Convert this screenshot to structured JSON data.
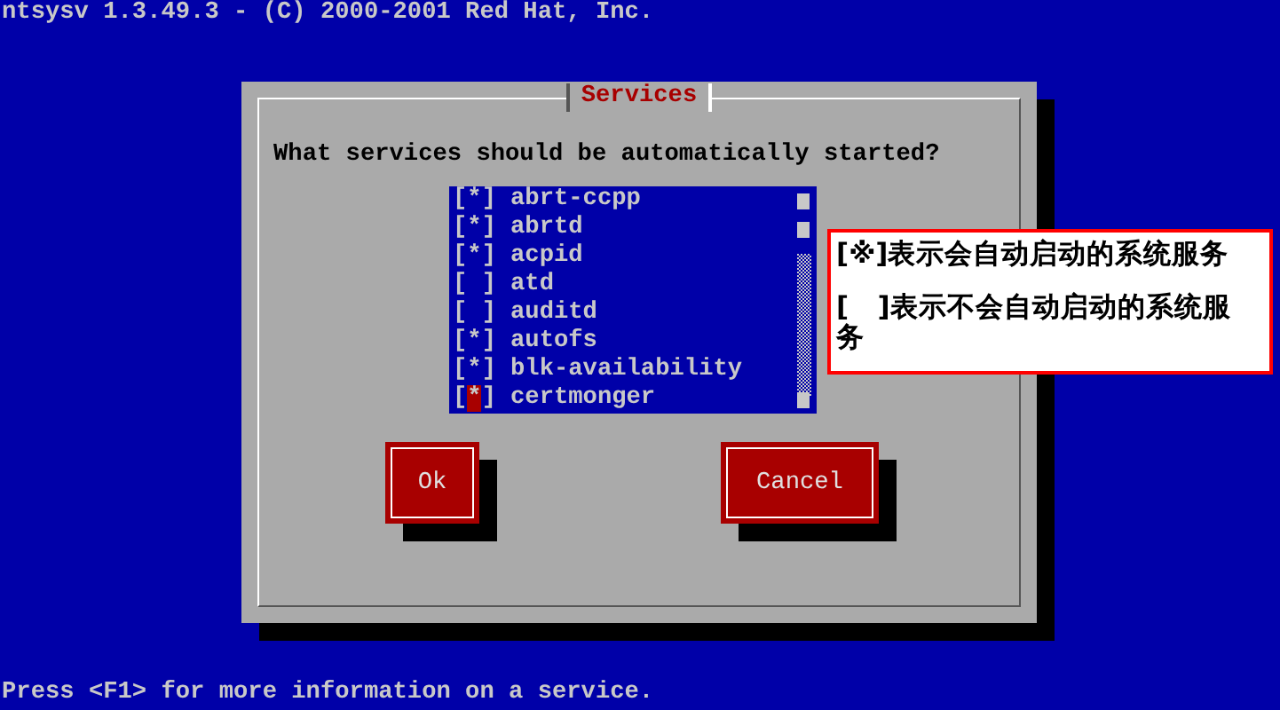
{
  "header": "ntsysv 1.3.49.3 - (C) 2000-2001 Red Hat, Inc.",
  "dialog": {
    "title": "Services",
    "question": "What services should be automatically started?",
    "services": [
      {
        "name": "abrt-ccpp",
        "checkbox": "[*]",
        "selected": false
      },
      {
        "name": "abrtd",
        "checkbox": "[*]",
        "selected": false
      },
      {
        "name": "acpid",
        "checkbox": "[*]",
        "selected": false
      },
      {
        "name": "atd",
        "checkbox": "[ ]",
        "selected": false
      },
      {
        "name": "auditd",
        "checkbox": "[ ]",
        "selected": false
      },
      {
        "name": "autofs",
        "checkbox": "[*]",
        "selected": false
      },
      {
        "name": "blk-availability",
        "checkbox": "[*]",
        "selected": false
      },
      {
        "name": "certmonger",
        "checkbox": "[*]",
        "selected": true
      }
    ],
    "buttons": [
      "Ok",
      "Cancel"
    ]
  },
  "annotation": {
    "lines": [
      "[※]表示会自动启动的系统服务",
      "[   ]表示不会自动启动的系统服务"
    ]
  },
  "status_bar": "Press <F1> for more information on a service."
}
